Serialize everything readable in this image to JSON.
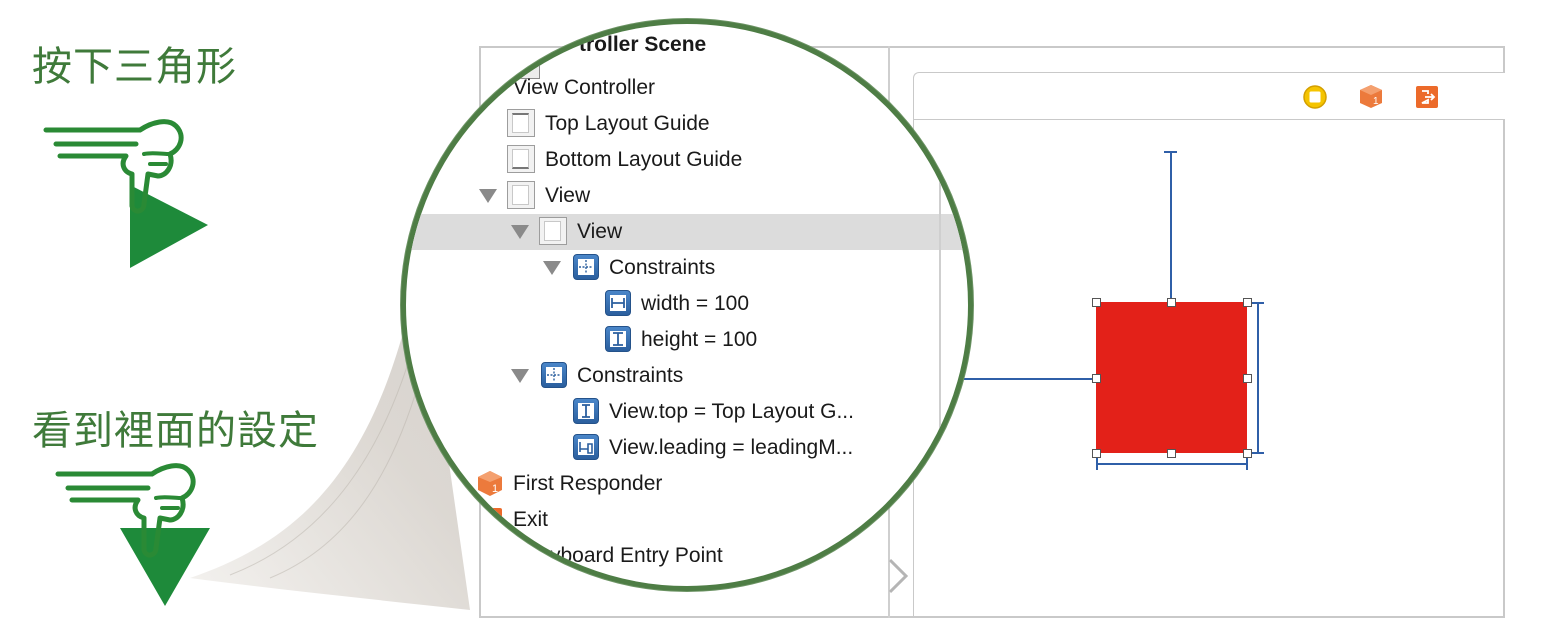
{
  "captions": {
    "top": "按下三角形",
    "bottom": "看到裡面的設定"
  },
  "outline": {
    "scene_title": "troller Scene",
    "items": [
      {
        "label": "View Controller"
      },
      {
        "label": "Top Layout Guide"
      },
      {
        "label": "Bottom Layout Guide"
      },
      {
        "label": "View"
      },
      {
        "label": "View"
      },
      {
        "label": "Constraints"
      },
      {
        "label": "width = 100"
      },
      {
        "label": "height = 100"
      },
      {
        "label": "Constraints"
      },
      {
        "label": "View.top = Top Layout G..."
      },
      {
        "label": "View.leading = leadingM..."
      },
      {
        "label": "First Responder"
      },
      {
        "label": "Exit"
      },
      {
        "label": "ryboard Entry Point"
      }
    ]
  },
  "canvas": {
    "toolbar_icons": [
      "view-controller-icon",
      "first-responder-icon",
      "exit-icon"
    ]
  },
  "colors": {
    "accent_green": "#3f7a3a",
    "arrow_green": "#1e8a3a",
    "red_view": "#e32119",
    "constraint_blue": "#2f5fa8",
    "selection": "#dcdcdc"
  }
}
